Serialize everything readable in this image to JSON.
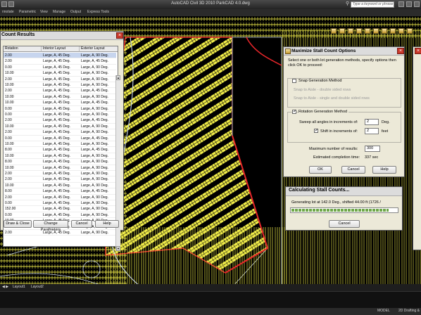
{
  "window": {
    "title": "AutoCAD Civil 3D 2010    ParkCAD 4.0.dwg",
    "search_placeholder": "Type a keyword or phrase"
  },
  "menu": [
    "nnotate",
    "Parametric",
    "View",
    "Manage",
    "Output",
    "Express Tools"
  ],
  "layout_tabs": [
    "Layout1",
    "Layout2"
  ],
  "status": {
    "model_label": "MODEL",
    "workspace": "2D Drafting &"
  },
  "results_dialog": {
    "title": "Count Results",
    "columns": [
      "Rotation",
      "Interior Layout",
      "Exterior Layout"
    ],
    "rows": [
      [
        "2.00",
        "Large, A, 45 Deg.",
        "Large, A, 90 Deg."
      ],
      [
        "2.00",
        "Large, A, 45 Deg.",
        "Large, A, 45 Deg."
      ],
      [
        "0.00",
        "Large, A, 45 Deg.",
        "Large, A, 90 Deg."
      ],
      [
        "10.00",
        "Large, A, 45 Deg.",
        "Large, A, 90 Deg."
      ],
      [
        "2.00",
        "Large, A, 45 Deg.",
        "Large, A, 90 Deg."
      ],
      [
        "10.00",
        "Large, A, 45 Deg.",
        "Large, A, 90 Deg."
      ],
      [
        "2.00",
        "Large, A, 45 Deg.",
        "Large, A, 45 Deg."
      ],
      [
        "10.00",
        "Large, A, 45 Deg.",
        "Large, A, 90 Deg."
      ],
      [
        "10.00",
        "Large, A, 45 Deg.",
        "Large, A, 45 Deg."
      ],
      [
        "0.00",
        "Large, A, 45 Deg.",
        "Large, A, 90 Deg."
      ],
      [
        "0.00",
        "Large, A, 45 Deg.",
        "Large, A, 90 Deg."
      ],
      [
        "2.00",
        "Large, A, 45 Deg.",
        "Large, A, 45 Deg."
      ],
      [
        "10.00",
        "Large, A, 45 Deg.",
        "Large, A, 90 Deg."
      ],
      [
        "2.00",
        "Large, A, 45 Deg.",
        "Large, A, 90 Deg."
      ],
      [
        "0.00",
        "Large, A, 45 Deg.",
        "Large, A, 45 Deg."
      ],
      [
        "10.00",
        "Large, A, 45 Deg.",
        "Large, A, 90 Deg."
      ],
      [
        "8.00",
        "Large, A, 45 Deg.",
        "Large, A, 45 Deg."
      ],
      [
        "10.00",
        "Large, A, 45 Deg.",
        "Large, A, 90 Deg."
      ],
      [
        "8.00",
        "Large, A, 45 Deg.",
        "Large, A, 90 Deg."
      ],
      [
        "10.00",
        "Large, A, 45 Deg.",
        "Large, A, 90 Deg."
      ],
      [
        "2.00",
        "Large, A, 45 Deg.",
        "Large, A, 90 Deg."
      ],
      [
        "2.00",
        "Large, A, 45 Deg.",
        "Large, A, 90 Deg."
      ],
      [
        "10.00",
        "Large, A, 45 Deg.",
        "Large, A, 90 Deg."
      ],
      [
        "8.00",
        "Large, A, 45 Deg.",
        "Large, A, 45 Deg."
      ],
      [
        "2.00",
        "Large, A, 45 Deg.",
        "Large, A, 90 Deg."
      ],
      [
        "0.00",
        "Large, A, 45 Deg.",
        "Large, A, 90 Deg."
      ],
      [
        "152.00",
        "Large, A, 45 Deg.",
        "Large, A, 90 Deg."
      ],
      [
        "0.00",
        "Large, A, 45 Deg.",
        "Large, A, 90 Deg."
      ],
      [
        "10.00",
        "Large, A, 45 Deg.",
        "Large, A, 90 Deg."
      ],
      [
        "8.00",
        "Large, A, 45 Deg.",
        "Large, A, 90 Deg."
      ],
      [
        "2.00",
        "Large, A, 45 Deg.",
        "Large, A, 90 Deg."
      ]
    ],
    "buttons": {
      "draw_close": "Draw & Close",
      "change_params": "Change Parameters",
      "cancel": "Cancel",
      "help": "Help"
    }
  },
  "maximize_dialog": {
    "title": "Maximize Stall Count Options",
    "instructions": "Select one or both lot generation methods, specify options then click OK to proceed:",
    "snap_method": {
      "label": "Snap Generation Method",
      "checked": false
    },
    "snap_double": "Snap to Aisle - double sided rows",
    "snap_single": "Snap to Aisle - single and double sided rows",
    "rotation_method": {
      "label": "Rotation Generation Method",
      "checked": true
    },
    "sweep_label": "Sweep all angles in increments of:",
    "sweep_value": "2",
    "sweep_unit": "Deg.",
    "shift_label": "Shift in increments of:",
    "shift_value": "2",
    "shift_unit": "feet",
    "shift_checked": true,
    "max_results_label": "Maximum number of results:",
    "max_results_value": "300",
    "completion_label": "Estimated completion time:",
    "completion_value": "337 sec",
    "buttons": {
      "ok": "OK",
      "cancel": "Cancel",
      "help": "Help"
    }
  },
  "progress_dialog": {
    "title": "Calculating Stall Counts...",
    "status": "Generating lot at 142.0 Deg., shifted 44.00 ft  (1726 /",
    "progress": 0.92,
    "cancel": "Cancel"
  },
  "colors": {
    "stall_lines": "#f2ee4a",
    "boundary": "#e8262a",
    "curb": "#c9d8ea",
    "background": "#000000"
  }
}
